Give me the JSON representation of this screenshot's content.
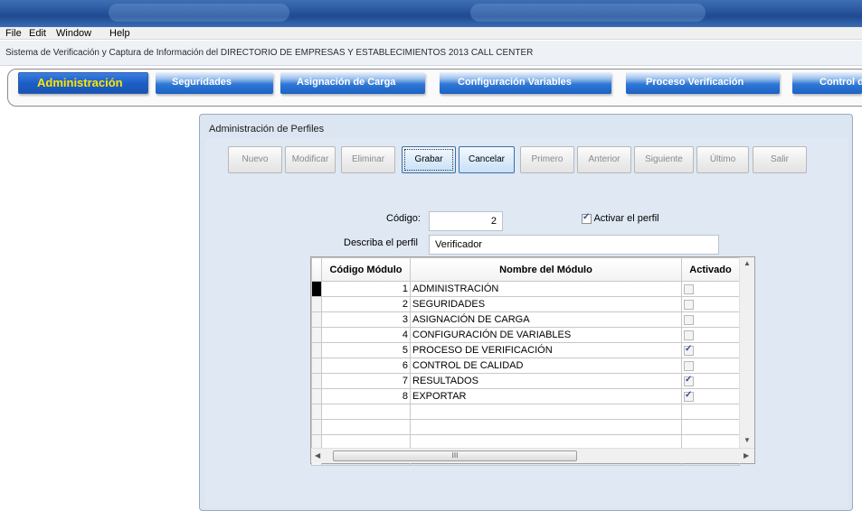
{
  "menu": [
    "File",
    "Edit",
    "Window",
    "Help"
  ],
  "app_caption": "Sistema de Verificación y Captura de Información del DIRECTORIO DE EMPRESAS Y ESTABLECIMIENTOS 2013   CALL CENTER",
  "nav": {
    "items": [
      "Administración",
      "Seguridades",
      "Asignación de Carga",
      "Configuración Variables",
      "Proceso Verificación",
      "Control d"
    ]
  },
  "panel": {
    "title": "Administración de Perfiles",
    "toolbar": [
      "Nuevo",
      "Modificar",
      "Eliminar",
      "Grabar",
      "Cancelar",
      "Primero",
      "Anterior",
      "Siguiente",
      "Último",
      "Salir"
    ],
    "codigo_label": "Código:",
    "codigo_value": "2",
    "activar_label": "Activar el perfil",
    "activar_checked": true,
    "describa_label": "Describa el perfil",
    "describa_value": "Verificador"
  },
  "grid": {
    "headers": [
      "Código Módulo",
      "Nombre del Módulo",
      "Activado"
    ],
    "rows": [
      {
        "codigo": "1",
        "nombre": "ADMINISTRACIÓN",
        "activado": false
      },
      {
        "codigo": "2",
        "nombre": "SEGURIDADES",
        "activado": false
      },
      {
        "codigo": "3",
        "nombre": "ASIGNACIÓN DE CARGA",
        "activado": false
      },
      {
        "codigo": "4",
        "nombre": "CONFIGURACIÓN DE VARIABLES",
        "activado": false
      },
      {
        "codigo": "5",
        "nombre": "PROCESO DE VERIFICACIÓN",
        "activado": true
      },
      {
        "codigo": "6",
        "nombre": "CONTROL DE CALIDAD",
        "activado": false
      },
      {
        "codigo": "7",
        "nombre": "RESULTADOS",
        "activado": true
      },
      {
        "codigo": "8",
        "nombre": "EXPORTAR",
        "activado": true
      }
    ],
    "scroll_thumb_label": "III"
  },
  "colors": {
    "nav_blue": "#1b62c4",
    "nav_active_text": "#ffe600",
    "panel_bg": "#dce6f2"
  }
}
